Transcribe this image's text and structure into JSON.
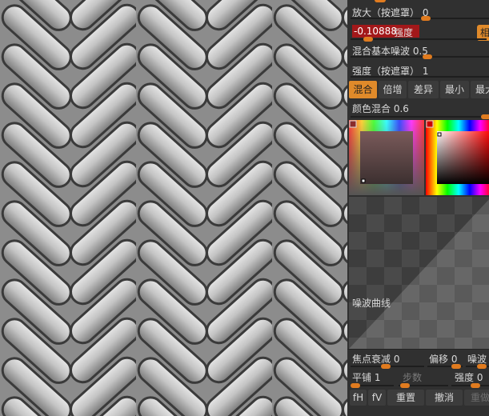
{
  "panel": {
    "zoom_mask": "放大（按遮罩）",
    "zoom_mask_value": "0",
    "strength_field_value": "-0.10888",
    "strength_label": "强度",
    "side_button_label": "相",
    "mix_base_noise": "混合基本噪波",
    "mix_base_noise_value": "0.5",
    "strength_mask": "强度（按遮罩）",
    "strength_mask_value": "1",
    "modes": [
      "混合",
      "倍增",
      "差异",
      "最小",
      "最大"
    ],
    "active_mode": "混合",
    "color_blend": "颜色混合",
    "color_blend_value": "0.6",
    "noise_curve": "噪波曲线",
    "focal_falloff": "焦点衰减",
    "focal_falloff_value": "0",
    "offset": "偏移",
    "offset_value": "0",
    "noise_short": "噪波",
    "tile": "平铺",
    "tile_value": "1",
    "steps": "步数",
    "strength2": "强度",
    "strength2_value": "0",
    "buttons": {
      "fh": "fH",
      "fv": "fV",
      "reset": "重置",
      "undo": "撤消",
      "redo": "重做"
    }
  },
  "colors": {
    "accent": "#e08a2a",
    "field_red": "#a3181a",
    "panel_bg": "#303030"
  }
}
